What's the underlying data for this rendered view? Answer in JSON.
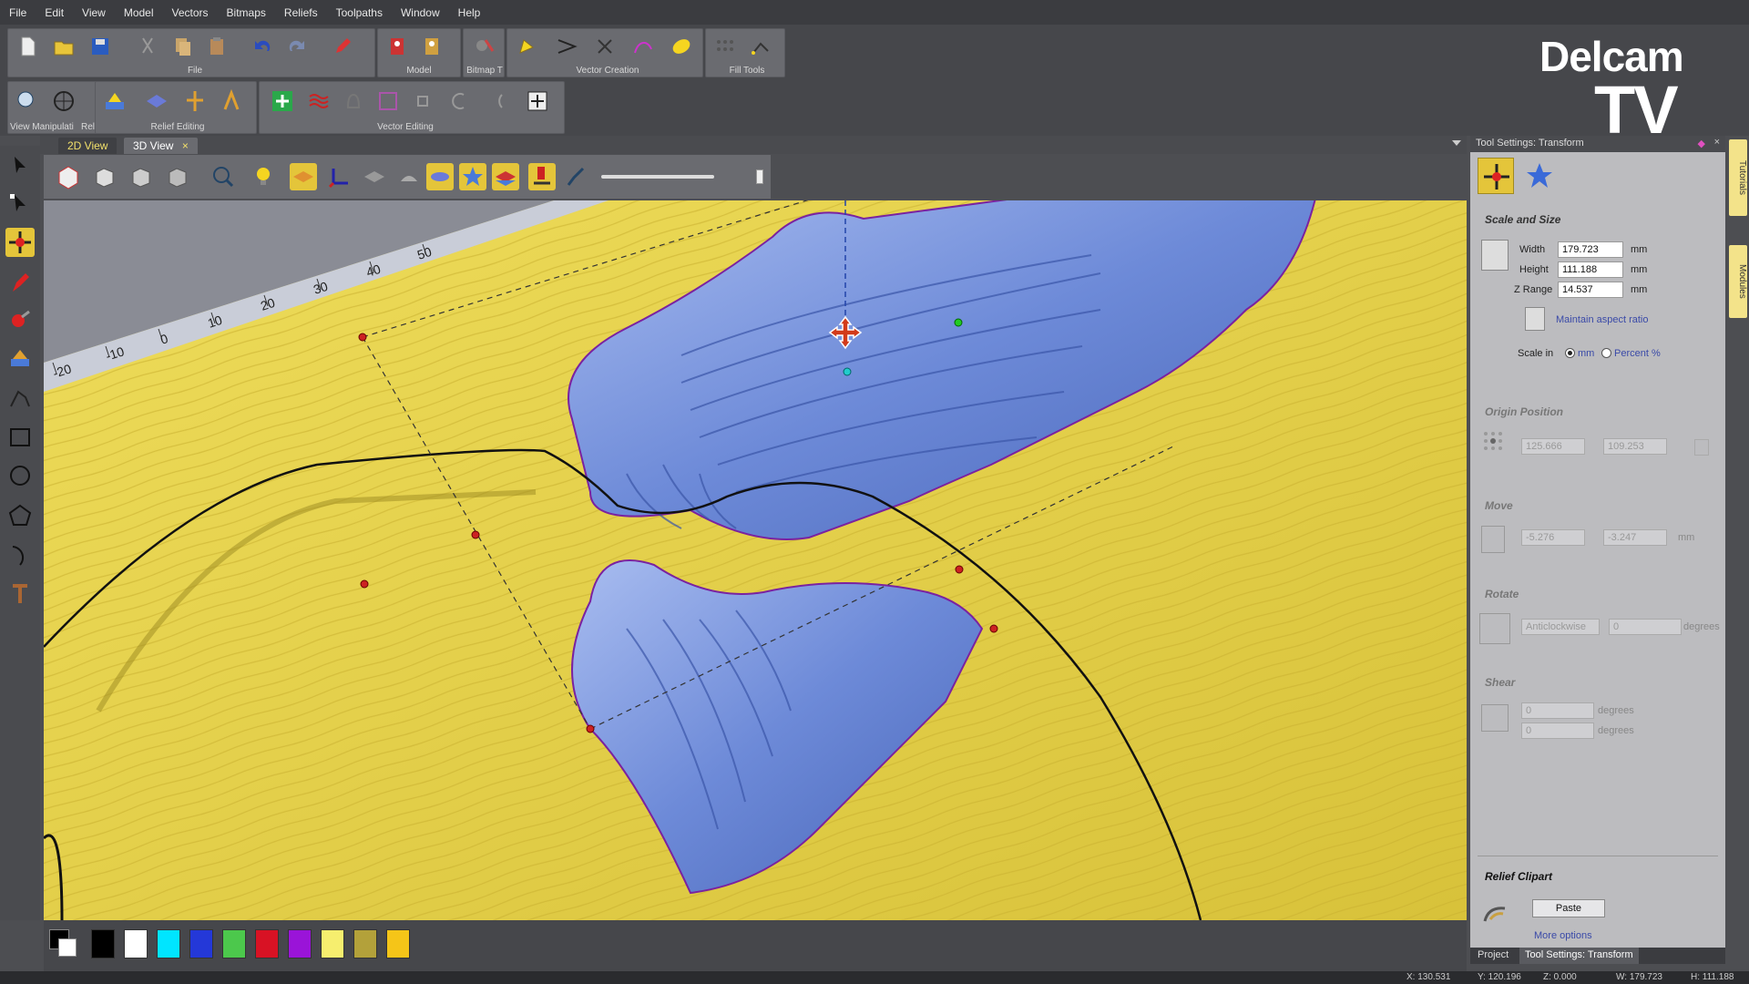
{
  "menu": [
    "File",
    "Edit",
    "View",
    "Model",
    "Vectors",
    "Bitmaps",
    "Reliefs",
    "Toolpaths",
    "Window",
    "Help"
  ],
  "toolbar_groups": {
    "file": "File",
    "model": "Model",
    "bitmap": "Bitmap T",
    "vector_creation": "Vector Creation",
    "fill_tools": "Fill Tools",
    "view_manipulation": "View Manipulati",
    "relief_cr": "Relief Cr",
    "relief_editing": "Relief Editing",
    "vector_editing": "Vector Editing"
  },
  "logo": {
    "line1": "Delcam",
    "line2": "TV"
  },
  "tabs": {
    "tab1": "2D View",
    "tab2": "3D View",
    "close": "×"
  },
  "ruler_labels": [
    "-20",
    "-10",
    "0",
    "10",
    "20",
    "30",
    "40",
    "50"
  ],
  "panel": {
    "title": "Tool Settings: Transform",
    "scale_size": "Scale and Size",
    "width_label": "Width",
    "width_value": "179.723",
    "height_label": "Height",
    "height_value": "111.188",
    "zrange_label": "Z Range",
    "zrange_value": "14.537",
    "unit": "mm",
    "maintain": "Maintain aspect ratio",
    "scale_in": "Scale in",
    "opt_mm": "mm",
    "opt_percent": "Percent %",
    "origin": "Origin Position",
    "origin_x": "125.666",
    "origin_y": "109.253",
    "move": "Move",
    "move_x": "-5.276",
    "move_y": "-3.247",
    "rotate": "Rotate",
    "rotate_dir": "Anticlockwise",
    "rotate_val": "0",
    "degrees": "degrees",
    "shear": "Shear",
    "shear_x": "0",
    "shear_y": "0",
    "relief_clipart": "Relief Clipart",
    "paste": "Paste",
    "more": "More options"
  },
  "panel_tabs": {
    "project": "Project",
    "tool_settings": "Tool Settings: Transform"
  },
  "side_tabs": {
    "tutorials": "Tutorials",
    "modules": "Modules"
  },
  "palette_colors": [
    "#000000",
    "#ffffff",
    "#00e5ff",
    "#2438d8",
    "#4cc84c",
    "#d81224",
    "#9a14d8",
    "#f6ee6e",
    "#b3a13a",
    "#f5c518"
  ],
  "status": {
    "x": "X: 130.531",
    "y": "Y: 120.196",
    "z": "Z: 0.000",
    "w": "W: 179.723",
    "h": "H: 111.188"
  }
}
